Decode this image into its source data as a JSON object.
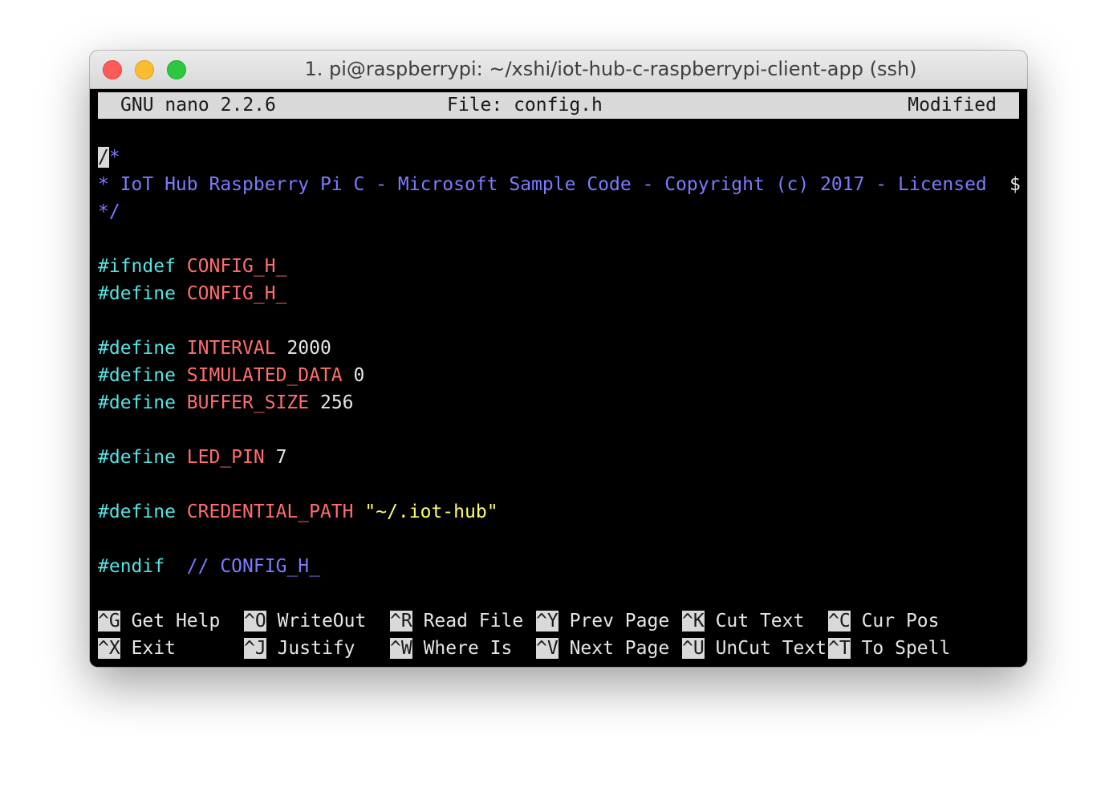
{
  "window": {
    "title": "1. pi@raspberrypi: ~/xshi/iot-hub-c-raspberrypi-client-app (ssh)"
  },
  "nano_header": {
    "version": "GNU nano 2.2.6",
    "file": "File: config.h",
    "status": "Modified"
  },
  "editor": {
    "comment_open_cursor": "/",
    "comment_open_rest": "*",
    "comment_body": "* IoT Hub Raspberry Pi C - Microsoft Sample Code - Copyright (c) 2017 - Licensed ",
    "overflow_marker": "$",
    "comment_close": "*/",
    "ifndef_kw": "#ifndef",
    "ifndef_name": "CONFIG_H_",
    "define_kw": "#define",
    "guard_name": "CONFIG_H_",
    "interval_name": "INTERVAL",
    "interval_value": "2000",
    "simulated_name": "SIMULATED_DATA",
    "simulated_value": "0",
    "buffer_name": "BUFFER_SIZE",
    "buffer_value": "256",
    "led_name": "LED_PIN",
    "led_value": "7",
    "cred_name": "CREDENTIAL_PATH",
    "cred_value": "\"~/.iot-hub\"",
    "endif_kw": "#endif",
    "endif_comment": "// CONFIG_H_"
  },
  "shortcuts": {
    "row1": [
      {
        "key": "^G",
        "label": "Get Help"
      },
      {
        "key": "^O",
        "label": "WriteOut"
      },
      {
        "key": "^R",
        "label": "Read File"
      },
      {
        "key": "^Y",
        "label": "Prev Page"
      },
      {
        "key": "^K",
        "label": "Cut Text"
      },
      {
        "key": "^C",
        "label": "Cur Pos"
      }
    ],
    "row2": [
      {
        "key": "^X",
        "label": "Exit"
      },
      {
        "key": "^J",
        "label": "Justify"
      },
      {
        "key": "^W",
        "label": "Where Is"
      },
      {
        "key": "^V",
        "label": "Next Page"
      },
      {
        "key": "^U",
        "label": "UnCut Text"
      },
      {
        "key": "^T",
        "label": "To Spell"
      }
    ]
  },
  "colors": {
    "comment": "#7b7bff",
    "keyword": "#55e3e3",
    "macro": "#ff6e6e",
    "string": "#ffff66",
    "background": "#000000"
  }
}
